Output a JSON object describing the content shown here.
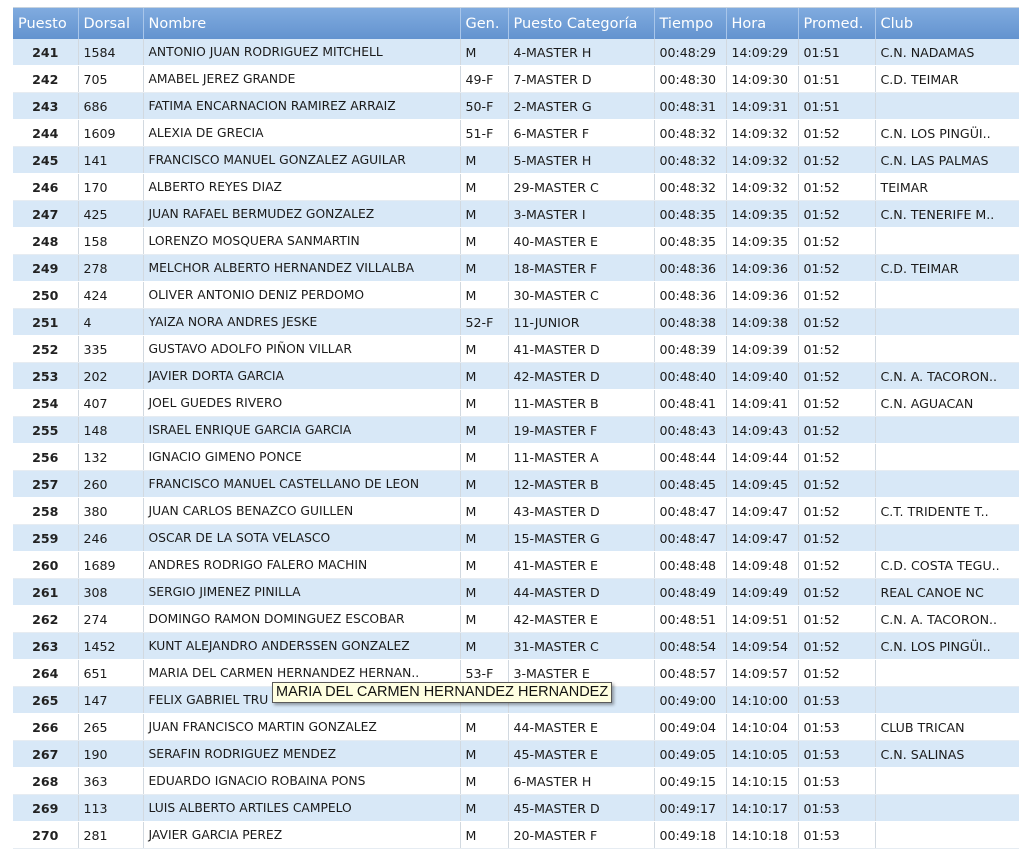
{
  "columns": {
    "puesto": "Puesto",
    "dorsal": "Dorsal",
    "nombre": "Nombre",
    "gen": "Gen.",
    "categoria": "Puesto Categoría",
    "tiempo": "Tiempo",
    "hora": "Hora",
    "promed": "Promed.",
    "club": "Club"
  },
  "rows": [
    {
      "puesto": "241",
      "dorsal": "1584",
      "nombre": "ANTONIO JUAN RODRIGUEZ MITCHELL",
      "gen": "M",
      "categoria": "4-MASTER H",
      "tiempo": "00:48:29",
      "hora": "14:09:29",
      "promed": "01:51",
      "club": "C.N. NADAMAS"
    },
    {
      "puesto": "242",
      "dorsal": "705",
      "nombre": "AMABEL JEREZ GRANDE",
      "gen": "49-F",
      "categoria": "7-MASTER D",
      "tiempo": "00:48:30",
      "hora": "14:09:30",
      "promed": "01:51",
      "club": "C.D. TEIMAR"
    },
    {
      "puesto": "243",
      "dorsal": "686",
      "nombre": "FATIMA ENCARNACION RAMIREZ ARRAIZ",
      "gen": "50-F",
      "categoria": "2-MASTER G",
      "tiempo": "00:48:31",
      "hora": "14:09:31",
      "promed": "01:51",
      "club": ""
    },
    {
      "puesto": "244",
      "dorsal": "1609",
      "nombre": "ALEXIA DE GRECIA",
      "gen": "51-F",
      "categoria": "6-MASTER F",
      "tiempo": "00:48:32",
      "hora": "14:09:32",
      "promed": "01:52",
      "club": "C.N. LOS PINGÜI.."
    },
    {
      "puesto": "245",
      "dorsal": "141",
      "nombre": "FRANCISCO MANUEL GONZALEZ AGUILAR",
      "gen": "M",
      "categoria": "5-MASTER H",
      "tiempo": "00:48:32",
      "hora": "14:09:32",
      "promed": "01:52",
      "club": "C.N. LAS PALMAS"
    },
    {
      "puesto": "246",
      "dorsal": "170",
      "nombre": "ALBERTO REYES DIAZ",
      "gen": "M",
      "categoria": "29-MASTER C",
      "tiempo": "00:48:32",
      "hora": "14:09:32",
      "promed": "01:52",
      "club": "TEIMAR"
    },
    {
      "puesto": "247",
      "dorsal": "425",
      "nombre": "JUAN RAFAEL BERMUDEZ GONZALEZ",
      "gen": "M",
      "categoria": "3-MASTER I",
      "tiempo": "00:48:35",
      "hora": "14:09:35",
      "promed": "01:52",
      "club": "C.N. TENERIFE M.."
    },
    {
      "puesto": "248",
      "dorsal": "158",
      "nombre": "LORENZO MOSQUERA SANMARTIN",
      "gen": "M",
      "categoria": "40-MASTER E",
      "tiempo": "00:48:35",
      "hora": "14:09:35",
      "promed": "01:52",
      "club": ""
    },
    {
      "puesto": "249",
      "dorsal": "278",
      "nombre": "MELCHOR ALBERTO HERNANDEZ VILLALBA",
      "gen": "M",
      "categoria": "18-MASTER F",
      "tiempo": "00:48:36",
      "hora": "14:09:36",
      "promed": "01:52",
      "club": "C.D. TEIMAR"
    },
    {
      "puesto": "250",
      "dorsal": "424",
      "nombre": "OLIVER ANTONIO DENIZ PERDOMO",
      "gen": "M",
      "categoria": "30-MASTER C",
      "tiempo": "00:48:36",
      "hora": "14:09:36",
      "promed": "01:52",
      "club": ""
    },
    {
      "puesto": "251",
      "dorsal": "4",
      "nombre": "YAIZA NORA ANDRES JESKE",
      "gen": "52-F",
      "categoria": "11-JUNIOR",
      "tiempo": "00:48:38",
      "hora": "14:09:38",
      "promed": "01:52",
      "club": ""
    },
    {
      "puesto": "252",
      "dorsal": "335",
      "nombre": "GUSTAVO ADOLFO PIÑON VILLAR",
      "gen": "M",
      "categoria": "41-MASTER D",
      "tiempo": "00:48:39",
      "hora": "14:09:39",
      "promed": "01:52",
      "club": ""
    },
    {
      "puesto": "253",
      "dorsal": "202",
      "nombre": "JAVIER DORTA GARCIA",
      "gen": "M",
      "categoria": "42-MASTER D",
      "tiempo": "00:48:40",
      "hora": "14:09:40",
      "promed": "01:52",
      "club": "C.N. A. TACORON.."
    },
    {
      "puesto": "254",
      "dorsal": "407",
      "nombre": "JOEL GUEDES RIVERO",
      "gen": "M",
      "categoria": "11-MASTER B",
      "tiempo": "00:48:41",
      "hora": "14:09:41",
      "promed": "01:52",
      "club": "C.N. AGUACAN"
    },
    {
      "puesto": "255",
      "dorsal": "148",
      "nombre": "ISRAEL ENRIQUE GARCIA GARCIA",
      "gen": "M",
      "categoria": "19-MASTER F",
      "tiempo": "00:48:43",
      "hora": "14:09:43",
      "promed": "01:52",
      "club": ""
    },
    {
      "puesto": "256",
      "dorsal": "132",
      "nombre": "IGNACIO GIMENO PONCE",
      "gen": "M",
      "categoria": "11-MASTER A",
      "tiempo": "00:48:44",
      "hora": "14:09:44",
      "promed": "01:52",
      "club": ""
    },
    {
      "puesto": "257",
      "dorsal": "260",
      "nombre": "FRANCISCO MANUEL CASTELLANO DE LEON",
      "gen": "M",
      "categoria": "12-MASTER B",
      "tiempo": "00:48:45",
      "hora": "14:09:45",
      "promed": "01:52",
      "club": ""
    },
    {
      "puesto": "258",
      "dorsal": "380",
      "nombre": "JUAN CARLOS BENAZCO GUILLEN",
      "gen": "M",
      "categoria": "43-MASTER D",
      "tiempo": "00:48:47",
      "hora": "14:09:47",
      "promed": "01:52",
      "club": "C.T. TRIDENTE T.."
    },
    {
      "puesto": "259",
      "dorsal": "246",
      "nombre": "OSCAR DE LA SOTA VELASCO",
      "gen": "M",
      "categoria": "15-MASTER G",
      "tiempo": "00:48:47",
      "hora": "14:09:47",
      "promed": "01:52",
      "club": ""
    },
    {
      "puesto": "260",
      "dorsal": "1689",
      "nombre": "ANDRES RODRIGO FALERO MACHIN",
      "gen": "M",
      "categoria": "41-MASTER E",
      "tiempo": "00:48:48",
      "hora": "14:09:48",
      "promed": "01:52",
      "club": "C.D. COSTA TEGU.."
    },
    {
      "puesto": "261",
      "dorsal": "308",
      "nombre": "SERGIO JIMENEZ PINILLA",
      "gen": "M",
      "categoria": "44-MASTER D",
      "tiempo": "00:48:49",
      "hora": "14:09:49",
      "promed": "01:52",
      "club": "REAL CANOE NC"
    },
    {
      "puesto": "262",
      "dorsal": "274",
      "nombre": "DOMINGO RAMON DOMINGUEZ ESCOBAR",
      "gen": "M",
      "categoria": "42-MASTER E",
      "tiempo": "00:48:51",
      "hora": "14:09:51",
      "promed": "01:52",
      "club": "C.N. A. TACORON.."
    },
    {
      "puesto": "263",
      "dorsal": "1452",
      "nombre": "KUNT ALEJANDRO ANDERSSEN GONZALEZ",
      "gen": "M",
      "categoria": "31-MASTER C",
      "tiempo": "00:48:54",
      "hora": "14:09:54",
      "promed": "01:52",
      "club": "C.N. LOS PINGÜI.."
    },
    {
      "puesto": "264",
      "dorsal": "651",
      "nombre": "MARIA DEL CARMEN HERNANDEZ HERNAN..",
      "gen": "53-F",
      "categoria": "3-MASTER E",
      "tiempo": "00:48:57",
      "hora": "14:09:57",
      "promed": "01:52",
      "club": ""
    },
    {
      "puesto": "265",
      "dorsal": "147",
      "nombre": "FELIX GABRIEL TRU",
      "gen": "",
      "categoria": "",
      "tiempo": "00:49:00",
      "hora": "14:10:00",
      "promed": "01:53",
      "club": ""
    },
    {
      "puesto": "266",
      "dorsal": "265",
      "nombre": "JUAN FRANCISCO MARTIN GONZALEZ",
      "gen": "M",
      "categoria": "44-MASTER E",
      "tiempo": "00:49:04",
      "hora": "14:10:04",
      "promed": "01:53",
      "club": "CLUB TRICAN"
    },
    {
      "puesto": "267",
      "dorsal": "190",
      "nombre": "SERAFIN RODRIGUEZ MENDEZ",
      "gen": "M",
      "categoria": "45-MASTER E",
      "tiempo": "00:49:05",
      "hora": "14:10:05",
      "promed": "01:53",
      "club": "C.N. SALINAS"
    },
    {
      "puesto": "268",
      "dorsal": "363",
      "nombre": "EDUARDO IGNACIO ROBAINA PONS",
      "gen": "M",
      "categoria": "6-MASTER H",
      "tiempo": "00:49:15",
      "hora": "14:10:15",
      "promed": "01:53",
      "club": ""
    },
    {
      "puesto": "269",
      "dorsal": "113",
      "nombre": "LUIS ALBERTO ARTILES CAMPELO",
      "gen": "M",
      "categoria": "45-MASTER D",
      "tiempo": "00:49:17",
      "hora": "14:10:17",
      "promed": "01:53",
      "club": ""
    },
    {
      "puesto": "270",
      "dorsal": "281",
      "nombre": "JAVIER GARCIA PEREZ",
      "gen": "M",
      "categoria": "20-MASTER F",
      "tiempo": "00:49:18",
      "hora": "14:10:18",
      "promed": "01:53",
      "club": ""
    }
  ],
  "tooltip": {
    "text": "MARIA DEL CARMEN HERNANDEZ HERNANDEZ"
  }
}
